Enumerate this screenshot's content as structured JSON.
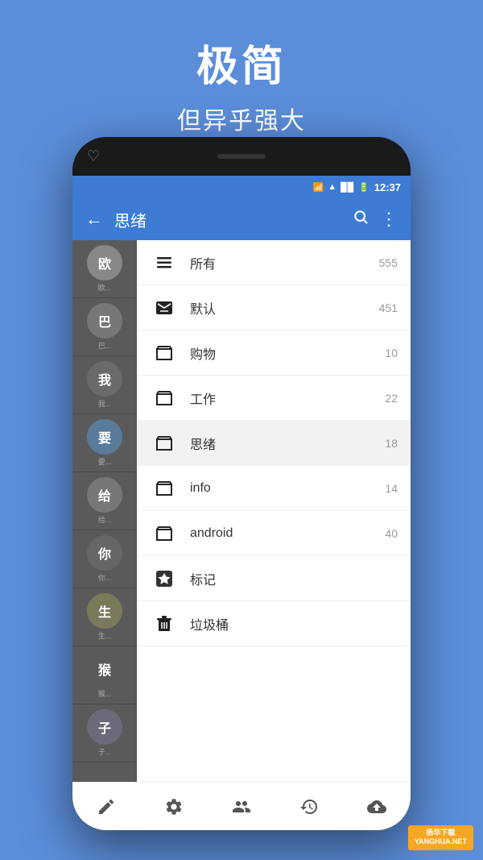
{
  "background_color": "#5b8dd9",
  "top_text": {
    "title": "极简",
    "subtitle": "但异乎强大"
  },
  "status_bar": {
    "time": "12:37"
  },
  "toolbar": {
    "back_label": "←",
    "title": "思绪",
    "search_label": "🔍",
    "more_label": "⋮"
  },
  "sidebar": {
    "items": [
      {
        "avatar": "欧",
        "label": "欧..."
      },
      {
        "avatar": "巴",
        "label": "巴..."
      },
      {
        "avatar": "我",
        "label": "我..."
      },
      {
        "avatar": "要",
        "label": "要..."
      },
      {
        "avatar": "给",
        "label": "给..."
      },
      {
        "avatar": "你",
        "label": "你..."
      },
      {
        "avatar": "生",
        "label": "生..."
      },
      {
        "avatar": "猴",
        "label": "猴..."
      },
      {
        "avatar": "子",
        "label": "子..."
      }
    ]
  },
  "menu": {
    "items": [
      {
        "icon": "list",
        "label": "所有",
        "count": "555",
        "active": false
      },
      {
        "icon": "inbox",
        "label": "默认",
        "count": "451",
        "active": false
      },
      {
        "icon": "folder",
        "label": "购物",
        "count": "10",
        "active": false
      },
      {
        "icon": "folder",
        "label": "工作",
        "count": "22",
        "active": false
      },
      {
        "icon": "folder",
        "label": "思绪",
        "count": "18",
        "active": true
      },
      {
        "icon": "folder",
        "label": "info",
        "count": "14",
        "active": false
      },
      {
        "icon": "folder",
        "label": "android",
        "count": "40",
        "active": false
      },
      {
        "icon": "star",
        "label": "标记",
        "count": "",
        "active": false
      },
      {
        "icon": "trash",
        "label": "垃圾桶",
        "count": "",
        "active": false
      }
    ]
  },
  "bottom_nav": {
    "items": [
      {
        "icon": "edit",
        "name": "edit-icon"
      },
      {
        "icon": "gear",
        "name": "settings-icon"
      },
      {
        "icon": "people",
        "name": "people-icon"
      },
      {
        "icon": "history",
        "name": "history-icon"
      },
      {
        "icon": "cloud",
        "name": "cloud-icon"
      }
    ]
  },
  "watermark": {
    "line1": "扬华下载",
    "line2": "YANGHUA.NET"
  }
}
